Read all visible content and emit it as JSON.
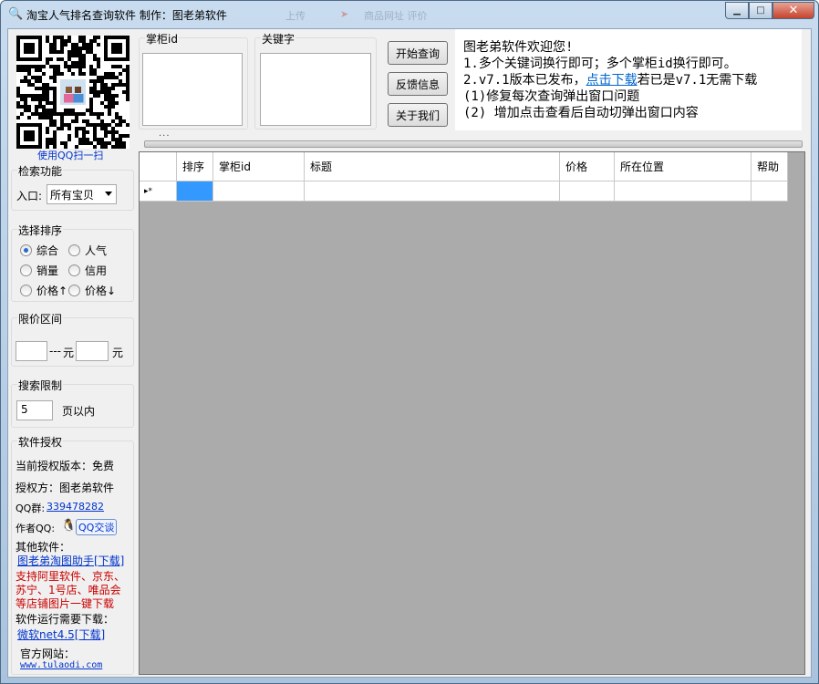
{
  "window": {
    "title": "淘宝人气排名查询软件  制作：图老弟软件",
    "title_icon": "magnifier-icon",
    "ghost_labels": [
      "上传",
      "商品网址 评价"
    ],
    "min_label": "▁",
    "max_label": "□",
    "close_label": "✕"
  },
  "qr": {
    "caption": "使用QQ扫一扫"
  },
  "inputs": {
    "seller_id_label": "掌柜id",
    "keyword_label": "关键字",
    "more_dots": "..."
  },
  "buttons": {
    "search": "开始查询",
    "feedback": "反馈信息",
    "about": "关于我们"
  },
  "welcome": {
    "line1": "图老弟软件欢迎您!",
    "line2": "1.多个关键词换行即可；多个掌柜id换行即可。",
    "line3_prefix": "2.v7.1版本已发布，",
    "line3_link": "点击下载",
    "line3_suffix": "若已是v7.1无需下载",
    "line4": "(1)修复每次查询弹出窗口问题",
    "line5": "(2) 增加点击查看后自动切弹出窗口内容"
  },
  "search_function": {
    "title": "检索功能",
    "entry_label": "入口:",
    "entry_value": "所有宝贝"
  },
  "sort": {
    "title": "选择排序",
    "options": [
      "综合",
      "人气",
      "销量",
      "信用",
      "价格↑",
      "价格↓"
    ],
    "selected": "综合"
  },
  "price_range": {
    "title": "限价区间",
    "min_value": "",
    "max_value": "",
    "sep": "---",
    "unit1": "元",
    "unit2": "元"
  },
  "search_limit": {
    "title": "搜索限制",
    "value": "5",
    "suffix": "页以内"
  },
  "license": {
    "title": "软件授权",
    "version": "当前授权版本：免费",
    "grantor": "授权方：图老弟软件",
    "qq_group_label": "QQ群:",
    "qq_group": "339478282",
    "author_qq_label": "作者QQ:",
    "author_qq_button": "QQ交谈",
    "other_label": "其他软件：",
    "other_link": "图老弟淘图助手[下载]",
    "promo": [
      "支持阿里软件、京东、",
      "苏宁、1号店、唯品会",
      "等店铺图片一键下载"
    ],
    "runtime_label": "软件运行需要下载：",
    "runtime_link": "微软net4.5[下载]",
    "site_label": "官方网站：",
    "site_link": "www.tulaodi.com"
  },
  "table": {
    "columns": [
      "排序",
      "掌柜id",
      "标题",
      "价格",
      "所在位置",
      "帮助"
    ],
    "new_row_marker": "▸*"
  }
}
